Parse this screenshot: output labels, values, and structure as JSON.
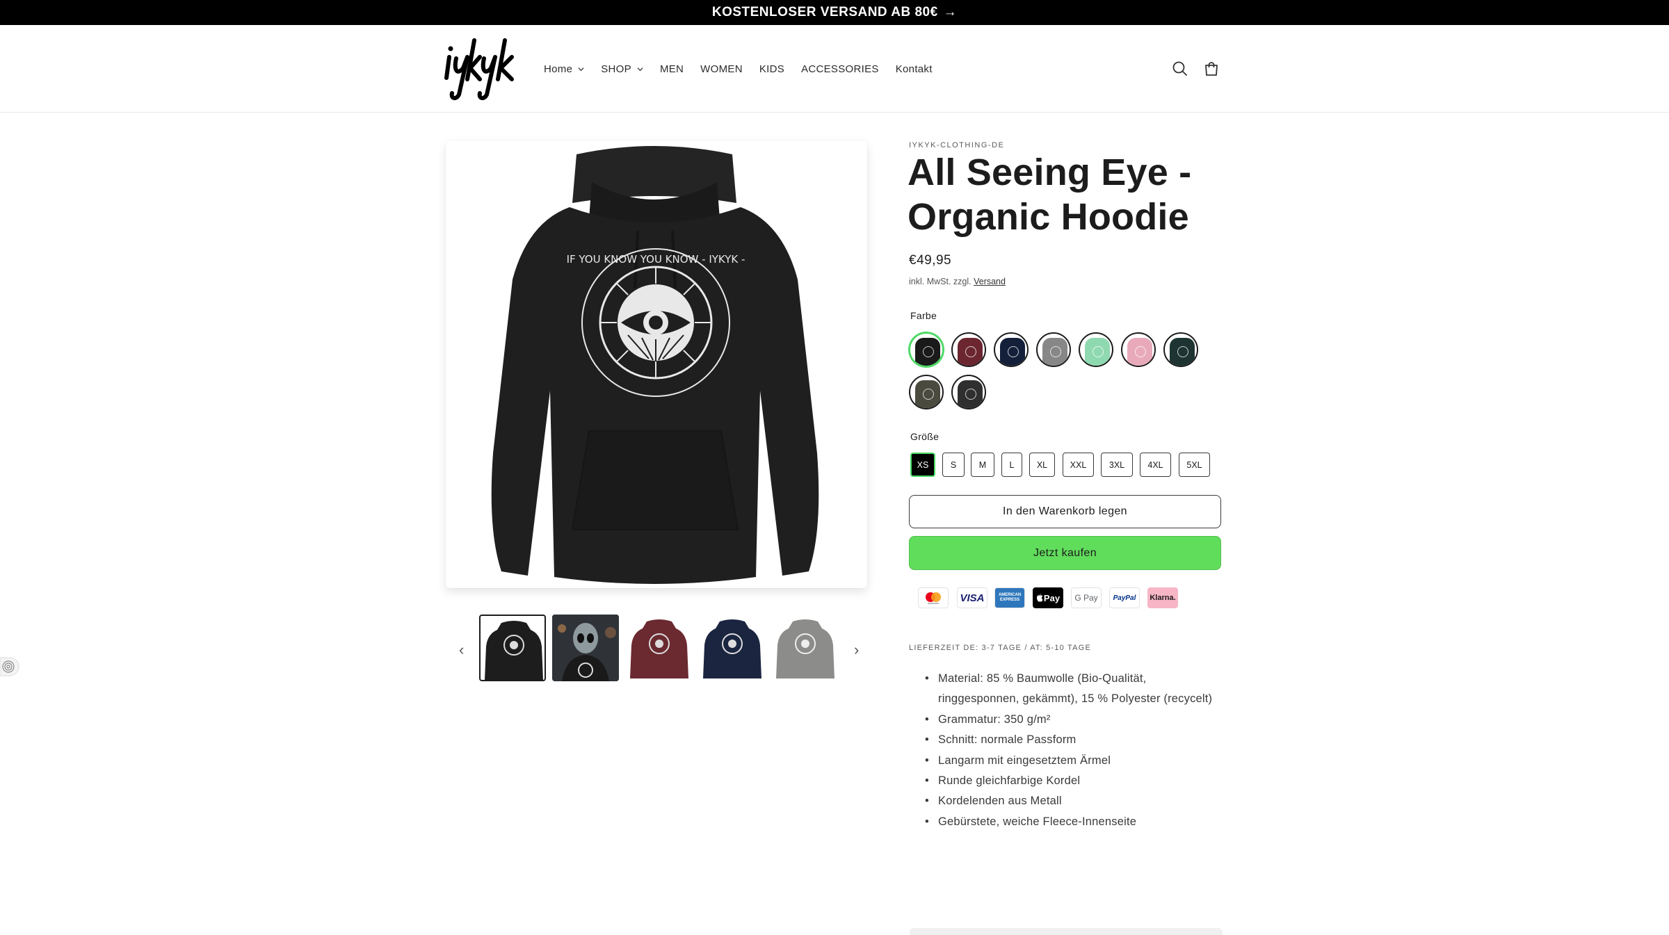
{
  "announcement": {
    "text": "KOSTENLOSER VERSAND AB 80€",
    "arrow": "→"
  },
  "header": {
    "logo_text": "iykyk",
    "nav": [
      {
        "label": "Home",
        "dropdown": true
      },
      {
        "label": "SHOP",
        "dropdown": true
      },
      {
        "label": "MEN",
        "dropdown": false
      },
      {
        "label": "WOMEN",
        "dropdown": false
      },
      {
        "label": "KIDS",
        "dropdown": false
      },
      {
        "label": "ACCESSORIES",
        "dropdown": false
      },
      {
        "label": "Kontakt",
        "dropdown": false
      }
    ],
    "icons": [
      "search-icon",
      "cart-icon"
    ]
  },
  "gallery": {
    "main_image": "black-hoodie-all-seeing-eye",
    "print_ring_text": "IF YOU KNOW YOU KNOW - IYKYK -",
    "thumbnails": [
      {
        "name": "black-hoodie",
        "color": "#1d1d1d",
        "active": true
      },
      {
        "name": "alien-model-photo",
        "color": "#3b3f44",
        "active": false
      },
      {
        "name": "burgundy-hoodie",
        "color": "#6b2a30",
        "active": false
      },
      {
        "name": "navy-hoodie",
        "color": "#1b2540",
        "active": false
      },
      {
        "name": "grey-hoodie",
        "color": "#8c8c8a",
        "active": false
      }
    ],
    "prev": "‹",
    "next": "›"
  },
  "product": {
    "vendor": "IYKYK-CLOTHING-DE",
    "title": "All Seeing Eye - Organic Hoodie",
    "price": "€49,95",
    "tax_note": "inkl. MwSt. zzgl.",
    "tax_link": "Versand",
    "color_label": "Farbe",
    "colors": [
      {
        "name": "Schwarz",
        "hex": "#1a1a1a",
        "active": true
      },
      {
        "name": "Burgundy",
        "hex": "#6b2630",
        "active": false
      },
      {
        "name": "Navy",
        "hex": "#141f3a",
        "active": false
      },
      {
        "name": "Grau",
        "hex": "#878787",
        "active": false
      },
      {
        "name": "Mint",
        "hex": "#8fd9b0",
        "active": false
      },
      {
        "name": "Rosa",
        "hex": "#e8aabb",
        "active": false
      },
      {
        "name": "Dunkelgrün",
        "hex": "#1d3432",
        "active": false
      },
      {
        "name": "Khaki",
        "hex": "#4a4a3f",
        "active": false
      },
      {
        "name": "Anthrazit",
        "hex": "#2f2f2f",
        "active": false
      }
    ],
    "size_label": "Größe",
    "sizes": [
      {
        "label": "XS",
        "active": true
      },
      {
        "label": "S",
        "active": false
      },
      {
        "label": "M",
        "active": false
      },
      {
        "label": "L",
        "active": false
      },
      {
        "label": "XL",
        "active": false
      },
      {
        "label": "XXL",
        "active": false
      },
      {
        "label": "3XL",
        "active": false
      },
      {
        "label": "4XL",
        "active": false
      },
      {
        "label": "5XL",
        "active": false
      }
    ],
    "add_to_cart": "In den Warenkorb legen",
    "buy_now": "Jetzt kaufen",
    "payment_methods": [
      {
        "name": "mastercard",
        "label": ""
      },
      {
        "name": "visa",
        "label": "VISA"
      },
      {
        "name": "american-express",
        "label": "AMERICAN EXPRESS"
      },
      {
        "name": "apple-pay",
        "label": "Pay"
      },
      {
        "name": "google-pay",
        "label": "G Pay"
      },
      {
        "name": "paypal",
        "label": "PayPal"
      },
      {
        "name": "klarna",
        "label": "Klarna."
      }
    ],
    "delivery": "LIEFERZEIT DE: 3-7 TAGE / AT: 5-10 TAGE",
    "features": [
      "Material: 85 % Baumwolle (Bio-Qualität, ringgesponnen, gekämmt), 15 % Polyester (recycelt)",
      "Grammatur: 350 g/m²",
      "Schnitt: normale Passform",
      "Langarm mit eingesetztem Ärmel",
      "Runde gleichfarbige Kordel",
      "Kordelenden aus Metall",
      "Gebürstete, weiche Fleece-Innenseite"
    ],
    "accent_green": "#61dd5c"
  }
}
